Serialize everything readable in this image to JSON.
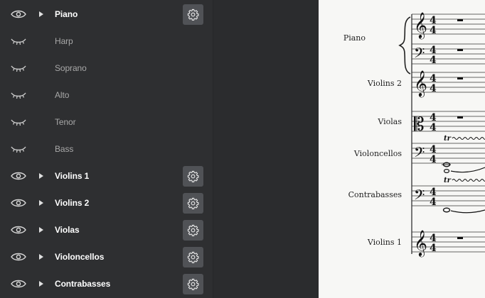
{
  "panel": {
    "rows": [
      {
        "label": "Piano",
        "visible": true,
        "expandable": true,
        "settings": true
      },
      {
        "label": "Harp",
        "visible": false,
        "expandable": false,
        "settings": false
      },
      {
        "label": "Soprano",
        "visible": false,
        "expandable": false,
        "settings": false
      },
      {
        "label": "Alto",
        "visible": false,
        "expandable": false,
        "settings": false
      },
      {
        "label": "Tenor",
        "visible": false,
        "expandable": false,
        "settings": false
      },
      {
        "label": "Bass",
        "visible": false,
        "expandable": false,
        "settings": false
      },
      {
        "label": "Violins 1",
        "visible": true,
        "expandable": true,
        "settings": true
      },
      {
        "label": "Violins 2",
        "visible": true,
        "expandable": true,
        "settings": true
      },
      {
        "label": "Violas",
        "visible": true,
        "expandable": true,
        "settings": true
      },
      {
        "label": "Violoncellos",
        "visible": true,
        "expandable": true,
        "settings": true
      },
      {
        "label": "Contrabasses",
        "visible": true,
        "expandable": true,
        "settings": true
      }
    ]
  },
  "score": {
    "staves": [
      {
        "name": "Piano",
        "clefs": [
          "treble",
          "bass"
        ],
        "time": "4/4"
      },
      {
        "name": "Violins 2",
        "clefs": [
          "treble"
        ],
        "time": "4/4"
      },
      {
        "name": "Violas",
        "clefs": [
          "alto"
        ],
        "time": "4/4"
      },
      {
        "name": "Violoncellos",
        "clefs": [
          "bass"
        ],
        "time": "4/4",
        "trill": "tr"
      },
      {
        "name": "Contrabasses",
        "clefs": [
          "bass"
        ],
        "time": "4/4",
        "trill": "tr"
      },
      {
        "name": "Violins 1",
        "clefs": [
          "treble"
        ],
        "time": "4/4"
      }
    ]
  },
  "colors": {
    "panel_bg": "#2e2f31",
    "text_on": "#ffffff",
    "text_off": "#a8a8a8",
    "button_bg": "#505256",
    "paper": "#f7f7f5"
  }
}
